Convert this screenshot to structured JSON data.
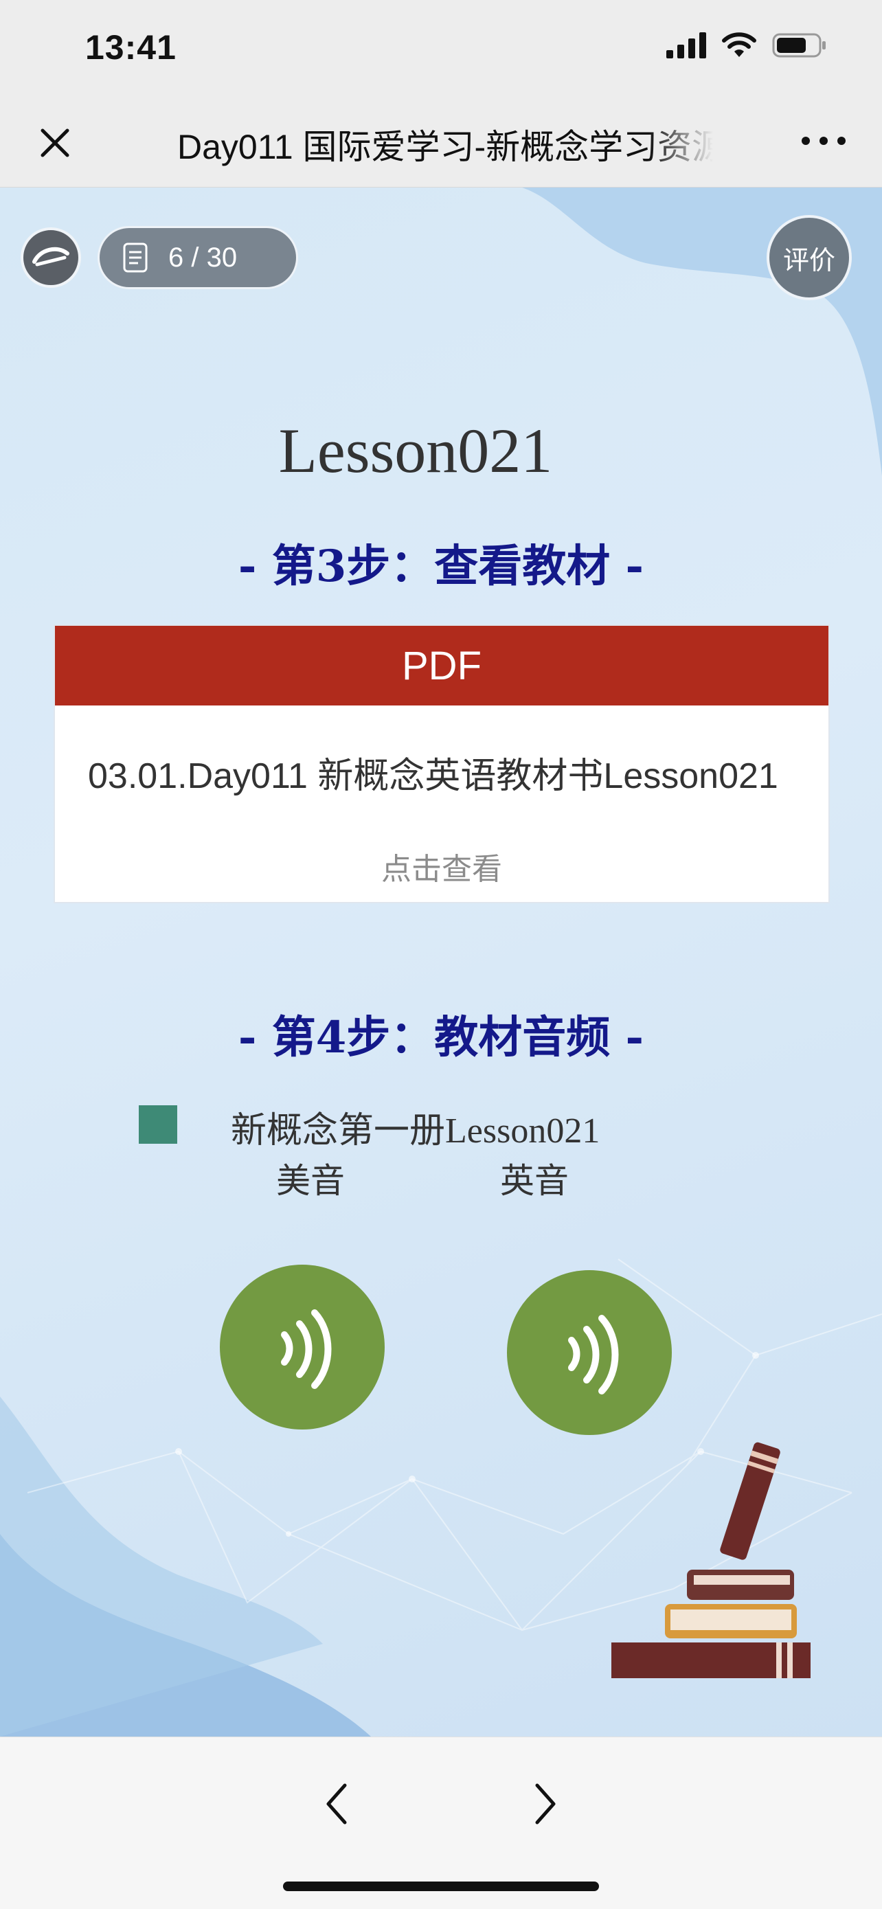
{
  "status_bar": {
    "time": "13:41"
  },
  "nav": {
    "title": "Day011 国际爱学习-新概念学习资源"
  },
  "top": {
    "page_indicator": "6 / 30",
    "rate_label": "评价"
  },
  "lesson": {
    "title": "Lesson021"
  },
  "step3": {
    "heading": "- 第3步：查看教材  -"
  },
  "pdf": {
    "header": "PDF",
    "filename": "03.01.Day011 新概念英语教材书Lesson021",
    "view_label": "点击查看"
  },
  "step4": {
    "heading": "- 第4步：教材音频 -"
  },
  "audio": {
    "name": "新概念第一册Lesson021",
    "us_label": "美音",
    "uk_label": "英音"
  },
  "colors": {
    "pdf_red": "#b02b1c",
    "heading_blue": "#14198a",
    "play_green": "#739a42",
    "square_green": "#3e8a76"
  },
  "icons": {
    "close": "close-icon",
    "more": "more-icon",
    "document": "document-icon",
    "audio": "sound-wave-icon",
    "prev": "chevron-left-icon",
    "next": "chevron-right-icon"
  }
}
